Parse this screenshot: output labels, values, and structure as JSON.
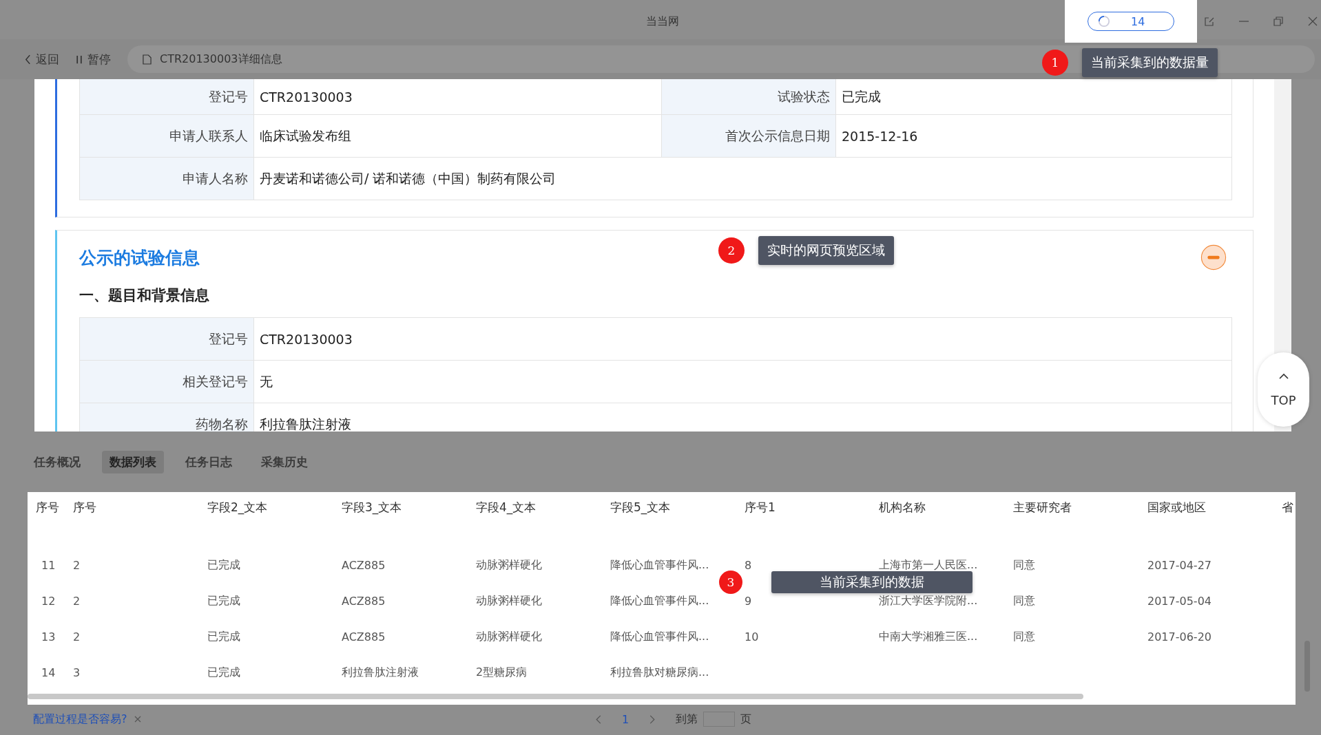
{
  "window": {
    "title": "当当网"
  },
  "counter": {
    "value": "14"
  },
  "toolbar": {
    "back": "返回",
    "pause": "暂停",
    "address": "CTR20130003详细信息"
  },
  "guides": [
    {
      "number": "1",
      "text": "当前采集到的数据量"
    },
    {
      "number": "2",
      "text": "实时的网页预览区域"
    },
    {
      "number": "3",
      "text": "当前采集到的数据"
    }
  ],
  "preview": {
    "info_rows": [
      [
        {
          "label": "登记号",
          "value": "CTR20130003"
        },
        {
          "label": "试验状态",
          "value": "已完成"
        }
      ],
      [
        {
          "label": "申请人联系人",
          "value": "临床试验发布组"
        },
        {
          "label": "首次公示信息日期",
          "value": "2015-12-16"
        }
      ],
      [
        {
          "label": "申请人名称",
          "value": "丹麦诺和诺德公司/ 诺和诺德（中国）制药有限公司"
        }
      ]
    ],
    "section_title": "公示的试验信息",
    "subsection": "一、题目和背景信息",
    "detail_rows": [
      {
        "label": "登记号",
        "value": "CTR20130003"
      },
      {
        "label": "相关登记号",
        "value": "无"
      },
      {
        "label": "药物名称",
        "value": "利拉鲁肽注射液"
      }
    ],
    "top_button": "TOP"
  },
  "panel": {
    "tabs": [
      {
        "label": "任务概况",
        "selected": false
      },
      {
        "label": "数据列表",
        "selected": true
      },
      {
        "label": "任务日志",
        "selected": false
      },
      {
        "label": "采集历史",
        "selected": false
      }
    ],
    "table": {
      "columns": [
        "序号",
        "序号",
        "字段2_文本",
        "字段3_文本",
        "字段4_文本",
        "字段5_文本",
        "序号1",
        "机构名称",
        "主要研究者",
        "国家或地区",
        "省"
      ],
      "rows": [
        [
          "11",
          "2",
          "已完成",
          "ACZ885",
          "动脉粥样硬化",
          "降低心血管事件风...",
          "8",
          "上海市第一人民医...",
          "同意",
          "2017-04-27"
        ],
        [
          "12",
          "2",
          "已完成",
          "ACZ885",
          "动脉粥样硬化",
          "降低心血管事件风...",
          "9",
          "浙江大学医学院附...",
          "同意",
          "2017-05-04"
        ],
        [
          "13",
          "2",
          "已完成",
          "ACZ885",
          "动脉粥样硬化",
          "降低心血管事件风...",
          "10",
          "中南大学湘雅三医...",
          "同意",
          "2017-06-20"
        ],
        [
          "14",
          "3",
          "已完成",
          "利拉鲁肽注射液",
          "2型糖尿病",
          "利拉鲁肽对糖尿病..."
        ]
      ]
    },
    "feedback_link": "配置过程是否容易?",
    "pagination": {
      "current": "1",
      "goto_label": "到第",
      "page_unit": "页"
    }
  }
}
